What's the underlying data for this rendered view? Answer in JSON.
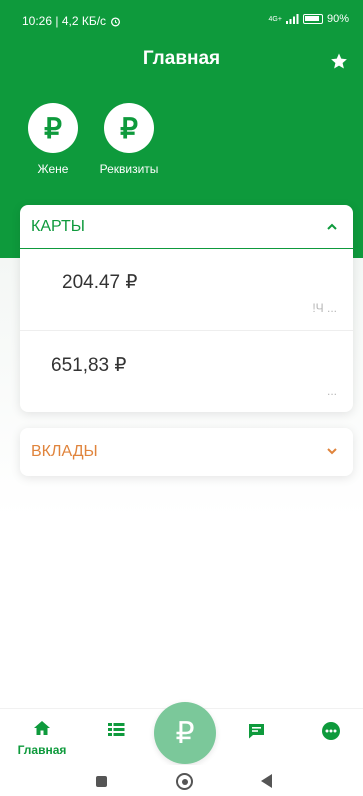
{
  "status": {
    "time_speed": "10:26 | 4,2 КБ/с",
    "network": "4G+",
    "battery": "90%"
  },
  "header": {
    "title": "Главная"
  },
  "quick_actions": [
    {
      "label": "Жене",
      "icon": "₽"
    },
    {
      "label": "Реквизиты",
      "icon": "₽"
    }
  ],
  "cards_section": {
    "title": "КАРТЫ",
    "expanded": true,
    "rows": [
      {
        "amount": "204.47 ₽",
        "mask": "!Ч ..."
      },
      {
        "amount": "651,83 ₽",
        "mask": "..."
      }
    ]
  },
  "deposits_section": {
    "title": "ВКЛАДЫ",
    "expanded": false
  },
  "tabbar": {
    "home_label": "Главная",
    "fab_icon": "₽"
  },
  "colors": {
    "brand": "#0e9a3c",
    "deposits": "#e0843c",
    "fab": "#7bc89a"
  }
}
